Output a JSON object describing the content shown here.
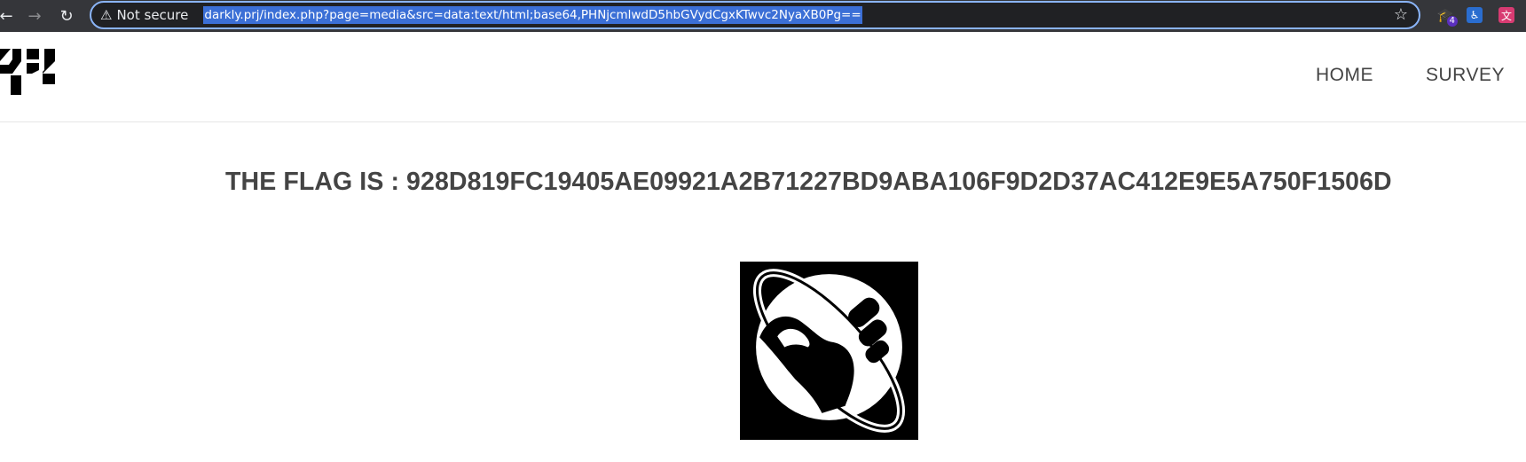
{
  "browser": {
    "back_icon": "arrow-left-icon",
    "forward_icon": "arrow-right-icon",
    "reload_icon": "reload-icon",
    "security_label": "Not secure",
    "security_icon": "warning-triangle-icon",
    "url": "darkly.prj/index.php?page=media&src=data:text/html;base64,PHNjcmlwdD5hbGVydCgxKTwvc2NyaXB0Pg==",
    "bookmark_icon": "star-icon",
    "extensions": [
      {
        "name": "graduation-cap-extension-icon",
        "badge": "4"
      },
      {
        "name": "accessibility-extension-icon"
      },
      {
        "name": "translate-extension-icon"
      }
    ],
    "accent_color": "#8ab4f8",
    "selection_color": "#3b6fd6"
  },
  "site": {
    "logo_name": "42-logo",
    "nav": {
      "home": "HOME",
      "survey": "SURVEY"
    }
  },
  "main": {
    "flag_text": "THE FLAG IS : 928D819FC19405AE09921A2B71227BD9ABA106F9D2D37AC412E9E5A750F1506D",
    "image_name": "thumbs-up-planet-icon"
  }
}
